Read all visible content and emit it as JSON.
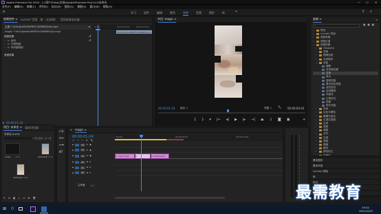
{
  "titlebar": {
    "title": "Adobe Premiere Pro 2020 - C:\\用户\\Edisp\\文档\\Adobe\\Premiere Pro\\14.0\\未命名",
    "minimize": "—",
    "maximize": "☐",
    "close": "✕"
  },
  "menu": [
    "文件(F)",
    "编辑(E)",
    "剪辑(C)",
    "序列(S)",
    "标记(M)",
    "图形(G)",
    "视图(V)",
    "窗口(W)",
    "帮助(H)"
  ],
  "workspaces": [
    "学习",
    "组件",
    "编辑",
    "颜色",
    "效果",
    "音频",
    "图形",
    "库"
  ],
  "active_workspace": "效果",
  "source_panel": {
    "tabs": [
      "效果控件 ≡",
      "Lumetri 范围",
      "源:（无剪辑）",
      "音频剪辑混合器:"
    ],
    "clip_header": "主要 * Ve3LdjxkMo9tIPBTlnSDRfMlQAA.mp4",
    "seq_header": "magic * Ve3LdjxkMo9tIPBTlnSDRfMlQAA.mp4",
    "timecode_start": "00:00",
    "timecode_mid": "00:00:05:00",
    "timecode_end": "00:00:10:00",
    "clip_bar_label": "Ve3LdjxkMo9tIPBTlnSDRfMlQAA.mp4",
    "section_video": "视频效果",
    "effects": [
      "运动",
      "不透明度",
      "时间重映射"
    ],
    "section_audio": "音频效果",
    "timecode": "00:00:01:24"
  },
  "program_monitor": {
    "tab": "节目: magic ≡",
    "timecode": "00:00:01:24",
    "fit": "适合",
    "quality": "完整",
    "duration": "00:00:04:03"
  },
  "effects_panel": {
    "tab": "效果 ≡",
    "items": [
      {
        "label": "预设",
        "type": "folder",
        "indent": 0,
        "chev": "›"
      },
      {
        "label": "Lumetri 预设",
        "type": "folder",
        "indent": 0,
        "chev": "›"
      },
      {
        "label": "音频效果",
        "type": "folder",
        "indent": 0,
        "chev": "›"
      },
      {
        "label": "音频过渡",
        "type": "folder",
        "indent": 0,
        "chev": "›"
      },
      {
        "label": "视频效果",
        "type": "folder",
        "indent": 0,
        "chev": "⌄"
      },
      {
        "label": "Obsolete",
        "type": "folder",
        "indent": 1,
        "chev": "›"
      },
      {
        "label": "变换",
        "type": "folder",
        "indent": 1,
        "chev": "›"
      },
      {
        "label": "图像控制",
        "type": "folder",
        "indent": 1,
        "chev": "›"
      },
      {
        "label": "实用程序",
        "type": "folder",
        "indent": 1,
        "chev": "›"
      },
      {
        "label": "扭曲",
        "type": "folder",
        "indent": 1,
        "chev": "⌄"
      },
      {
        "label": "偏移",
        "type": "fx",
        "indent": 2,
        "chev": ""
      },
      {
        "label": "变形稳定器",
        "type": "fx",
        "indent": 2,
        "chev": ""
      },
      {
        "label": "变换",
        "type": "fx",
        "indent": 2,
        "chev": "",
        "selected": true
      },
      {
        "label": "放大",
        "type": "fx",
        "indent": 2,
        "chev": ""
      },
      {
        "label": "旋转扭曲",
        "type": "fx",
        "indent": 2,
        "chev": ""
      },
      {
        "label": "果冻效应修复",
        "type": "fx",
        "indent": 2,
        "chev": ""
      },
      {
        "label": "波形变形",
        "type": "fx",
        "indent": 2,
        "chev": ""
      },
      {
        "label": "湍流置换",
        "type": "fx",
        "indent": 2,
        "chev": ""
      },
      {
        "label": "球面化",
        "type": "fx",
        "indent": 2,
        "chev": ""
      },
      {
        "label": "边角定位",
        "type": "fx",
        "indent": 2,
        "chev": ""
      },
      {
        "label": "镜像",
        "type": "fx",
        "indent": 2,
        "chev": ""
      },
      {
        "label": "镜头扭曲",
        "type": "fx",
        "indent": 2,
        "chev": ""
      },
      {
        "label": "时间",
        "type": "folder",
        "indent": 1,
        "chev": "›"
      },
      {
        "label": "杂色与颗粒",
        "type": "folder",
        "indent": 1,
        "chev": "›"
      },
      {
        "label": "模糊与锐化",
        "type": "folder",
        "indent": 1,
        "chev": "›"
      },
      {
        "label": "沉浸式视频",
        "type": "folder",
        "indent": 1,
        "chev": "›"
      },
      {
        "label": "生成",
        "type": "folder",
        "indent": 1,
        "chev": "›"
      },
      {
        "label": "视频",
        "type": "folder",
        "indent": 1,
        "chev": "›"
      },
      {
        "label": "调整",
        "type": "folder",
        "indent": 1,
        "chev": "›"
      },
      {
        "label": "过时",
        "type": "folder",
        "indent": 1,
        "chev": "›"
      },
      {
        "label": "过渡",
        "type": "folder",
        "indent": 1,
        "chev": "›"
      },
      {
        "label": "透视",
        "type": "folder",
        "indent": 1,
        "chev": "›"
      },
      {
        "label": "通道",
        "type": "folder",
        "indent": 1,
        "chev": "›"
      },
      {
        "label": "键控",
        "type": "folder",
        "indent": 1,
        "chev": "›"
      },
      {
        "label": "颜色校正",
        "type": "folder",
        "indent": 1,
        "chev": "›"
      },
      {
        "label": "风格化",
        "type": "folder",
        "indent": 1,
        "chev": "›"
      },
      {
        "label": "视频过渡",
        "type": "folder",
        "indent": 0,
        "chev": "›"
      }
    ],
    "lower_panels": [
      "基本图形",
      "基本声音",
      "Lumetri 颜色",
      "库",
      "标记",
      "历史记录",
      "信息"
    ]
  },
  "project_panel": {
    "tabs": [
      "项目: 未命名 ≡",
      "媒体浏览器"
    ],
    "project_file": "未命名.prproj",
    "item_count": "1 项已选择，共 3 项",
    "items": [
      {
        "name": "magic",
        "meta": "4:03"
      },
      {
        "name": "Ve3LdjxkMo9t...",
        "meta": "9:29"
      },
      {
        "name": "Ve3LdjxkMo9t...",
        "meta": "4:03"
      }
    ]
  },
  "timeline": {
    "tab": "magic ≡",
    "timecode": "00:00:01:24",
    "ruler": [
      ":00:00",
      "00:00:05:00",
      "00:00:10:00"
    ],
    "tracks": [
      {
        "label": "V3",
        "kind": "video"
      },
      {
        "label": "V2",
        "kind": "video"
      },
      {
        "label": "V1",
        "kind": "video"
      },
      {
        "label": "A1",
        "kind": "audio"
      },
      {
        "label": "A2",
        "kind": "audio"
      },
      {
        "label": "A3",
        "kind": "audio"
      }
    ],
    "master_label": "主声道",
    "master_value": "0.0",
    "clips": [
      {
        "label": "magic.mp4",
        "color": "#d48bd8"
      },
      {
        "label": "不透明度:不透明度",
        "color": "#e2c7e7"
      },
      {
        "label": "Ve3Ldjxk[V]",
        "color": "#d48bd8"
      }
    ]
  },
  "taskbar": {
    "time": "19:42",
    "date": "2021/10/15"
  },
  "watermark": "最需教育",
  "colors": {
    "accent_blue": "#3f8ee8",
    "clip_pink": "#d48bd8",
    "selected_row": "#3b3b3b"
  }
}
